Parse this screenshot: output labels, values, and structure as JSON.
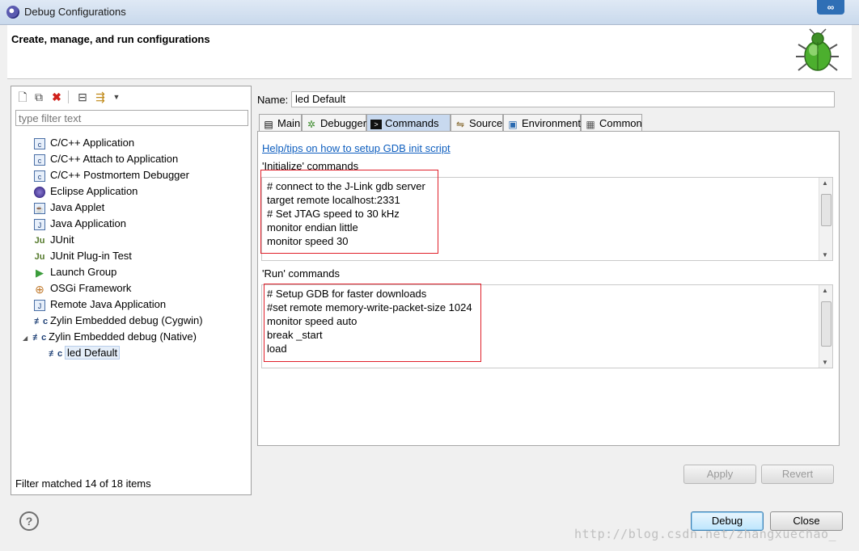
{
  "window": {
    "title": "Debug Configurations"
  },
  "header": {
    "heading": "Create, manage, and run configurations"
  },
  "left": {
    "filter_placeholder": "type filter text",
    "tree": [
      {
        "label": "C/C++ Application",
        "icon": "cpp-app-icon"
      },
      {
        "label": "C/C++ Attach to Application",
        "icon": "cpp-attach-icon"
      },
      {
        "label": "C/C++ Postmortem Debugger",
        "icon": "cpp-postmortem-icon"
      },
      {
        "label": "Eclipse Application",
        "icon": "eclipse-icon"
      },
      {
        "label": "Java Applet",
        "icon": "java-applet-icon"
      },
      {
        "label": "Java Application",
        "icon": "java-app-icon"
      },
      {
        "label": "JUnit",
        "icon": "junit-icon"
      },
      {
        "label": "JUnit Plug-in Test",
        "icon": "junit-plugin-icon"
      },
      {
        "label": "Launch Group",
        "icon": "launch-group-icon"
      },
      {
        "label": "OSGi Framework",
        "icon": "osgi-icon"
      },
      {
        "label": "Remote Java Application",
        "icon": "remote-java-icon"
      },
      {
        "label": "Zylin Embedded debug (Cygwin)",
        "icon": "zylin-icon"
      },
      {
        "label": "Zylin Embedded debug (Native)",
        "icon": "zylin-icon"
      },
      {
        "label": "led Default",
        "icon": "zylin-icon"
      }
    ],
    "status": "Filter matched 14 of 18 items"
  },
  "right": {
    "name_label": "Name:",
    "name_value": "led Default",
    "tabs": [
      "Main",
      "Debugger",
      "Commands",
      "Source",
      "Environment",
      "Common"
    ],
    "help_link": "Help/tips on how to setup GDB init script",
    "init_label": "'Initialize' commands",
    "init_lines": [
      "# connect to the J-Link gdb server",
      "target remote localhost:2331",
      "# Set JTAG speed to 30 kHz",
      "monitor endian little",
      "monitor speed 30"
    ],
    "run_label": "'Run' commands",
    "run_lines": [
      "# Setup GDB for faster downloads",
      "#set remote memory-write-packet-size 1024",
      "monitor speed auto",
      "break _start",
      "load"
    ],
    "apply": "Apply",
    "revert": "Revert"
  },
  "footer": {
    "debug": "Debug",
    "close": "Close",
    "help": "?"
  },
  "watermark": "http://blog.csdn.net/zhangxuechao_",
  "colors": {
    "highlight_box": "#e0202a",
    "link": "#0f5fbf",
    "active_tab": "#c8d9ef"
  }
}
